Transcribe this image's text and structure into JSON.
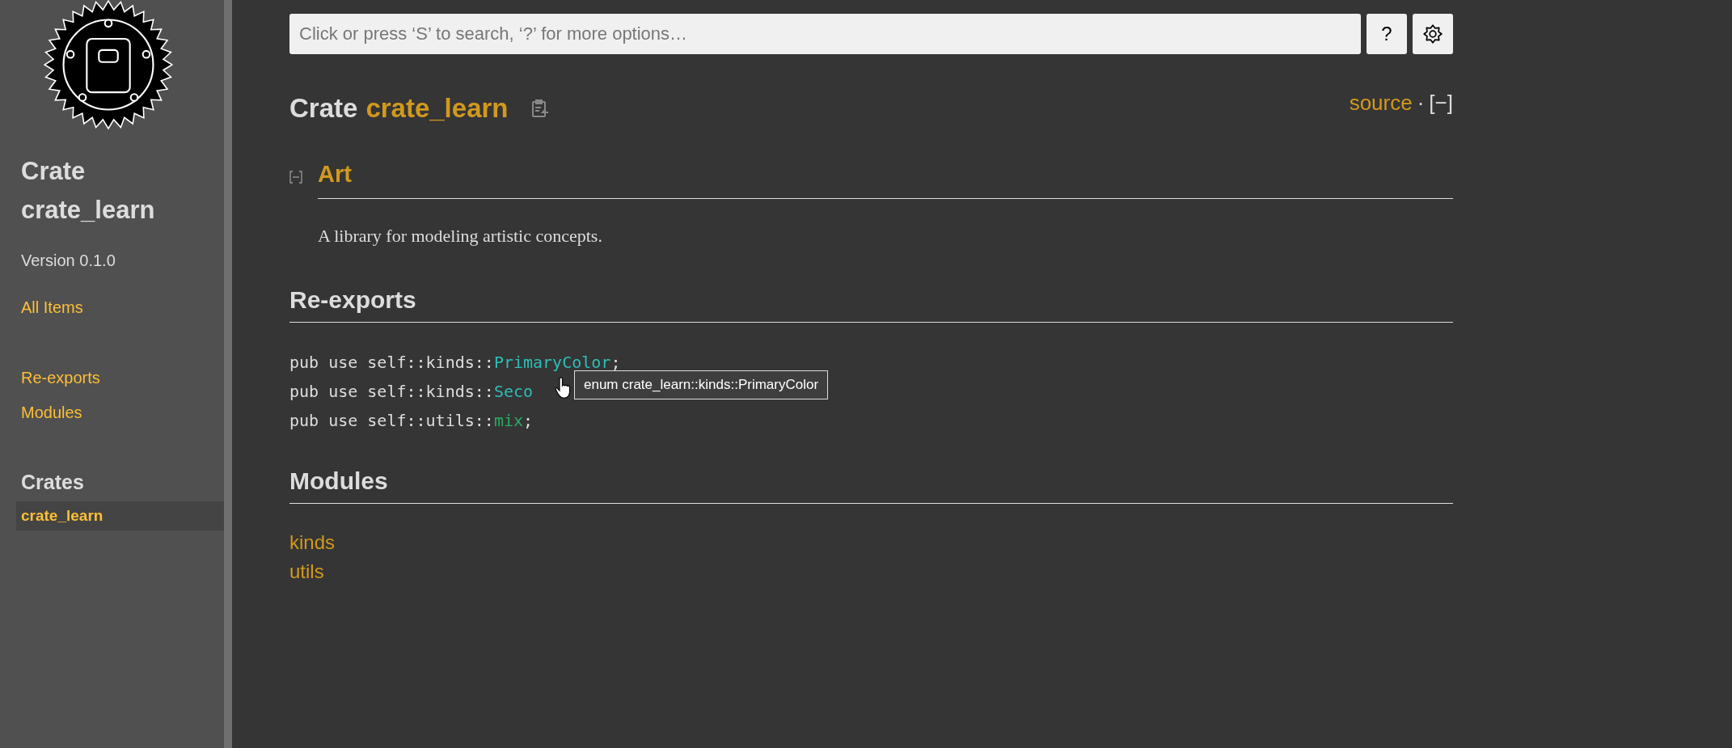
{
  "sidebar": {
    "crate_label": "Crate",
    "crate_name": "crate_learn",
    "version": "Version 0.1.0",
    "all_items": "All Items",
    "sections": [
      "Re-exports",
      "Modules"
    ],
    "crates_heading": "Crates",
    "crates": [
      {
        "label": "crate_learn",
        "selected": true
      }
    ]
  },
  "search": {
    "placeholder": "Click or press ‘S’ to search, ‘?’ for more options…"
  },
  "help_button": "?",
  "title": {
    "kind_label": "Crate",
    "name": "crate_learn"
  },
  "source_link": "source",
  "separator": "·",
  "collapse_all": "[−]",
  "docblock": {
    "heading": "Art",
    "expanded": true,
    "text": "A library for modeling artistic concepts."
  },
  "reexports": {
    "heading": "Re-exports",
    "items": [
      {
        "prefix": "pub use self::kinds::",
        "name": "PrimaryColor",
        "kind": "enum",
        "suffix": ";"
      },
      {
        "prefix": "pub use self::kinds::",
        "name": "Seco",
        "kind": "enum"
      },
      {
        "prefix": "pub use self::utils::",
        "name": "mix",
        "kind": "fn",
        "suffix": ";"
      }
    ]
  },
  "tooltip": "enum crate_learn::kinds::PrimaryColor",
  "modules": {
    "heading": "Modules",
    "items": [
      "kinds",
      "utils"
    ]
  }
}
